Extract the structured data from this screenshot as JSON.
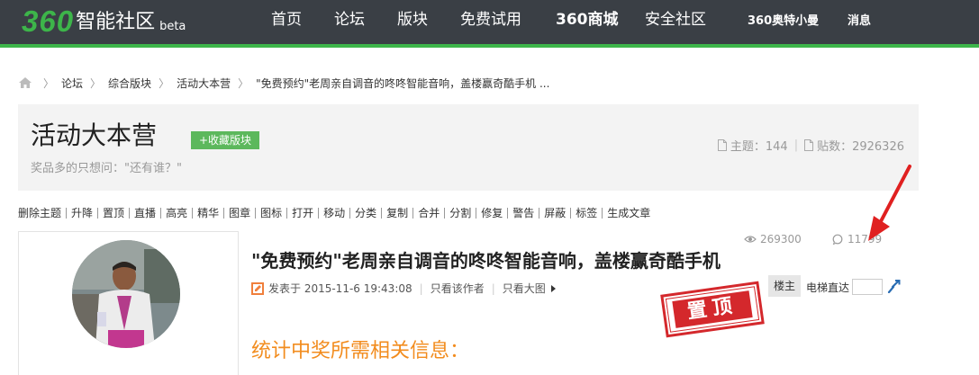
{
  "nav": {
    "logo_number": "360",
    "logo_text": "智能社区",
    "logo_beta": "beta",
    "items": [
      "首页",
      "论坛",
      "版块",
      "免费试用",
      "360商城",
      "安全社区"
    ],
    "user": "360奥特小曼",
    "messages": "消息"
  },
  "breadcrumb": {
    "items": [
      "论坛",
      "综合版块",
      "活动大本营",
      "\"免费预约\"老周亲自调音的咚咚智能音响，盖楼赢奇酷手机 ..."
    ],
    "separator": "〉"
  },
  "forum": {
    "title": "活动大本营",
    "favorite_button": "+收藏版块",
    "description": "奖品多的只想问：\"还有谁？\"",
    "topics_label": "主题：144",
    "posts_label": "贴数：2926326"
  },
  "toolbar": [
    "删除主题",
    "升降",
    "置顶",
    "直播",
    "高亮",
    "精华",
    "图章",
    "图标",
    "打开",
    "移动",
    "分类",
    "复制",
    "合并",
    "分割",
    "修复",
    "警告",
    "屏蔽",
    "标签",
    "生成文章"
  ],
  "post": {
    "views": "269300",
    "replies": "11799",
    "title": "\"免费预约\"老周亲自调音的咚咚智能音响，盖楼赢奇酷手机",
    "published": "发表于 2015-11-6 19:43:08",
    "only_author": "只看该作者",
    "only_big_image": "只看大图",
    "floor_tag": "楼主",
    "jump_label": "电梯直达",
    "jump_value": "",
    "stamp": "置顶",
    "section_heading": "统计中奖所需相关信息："
  },
  "colors": {
    "topbar": "#3a3f45",
    "brand_green": "#3db54a",
    "stamp_red": "#d4282c",
    "heading_orange": "#f28c1e"
  }
}
